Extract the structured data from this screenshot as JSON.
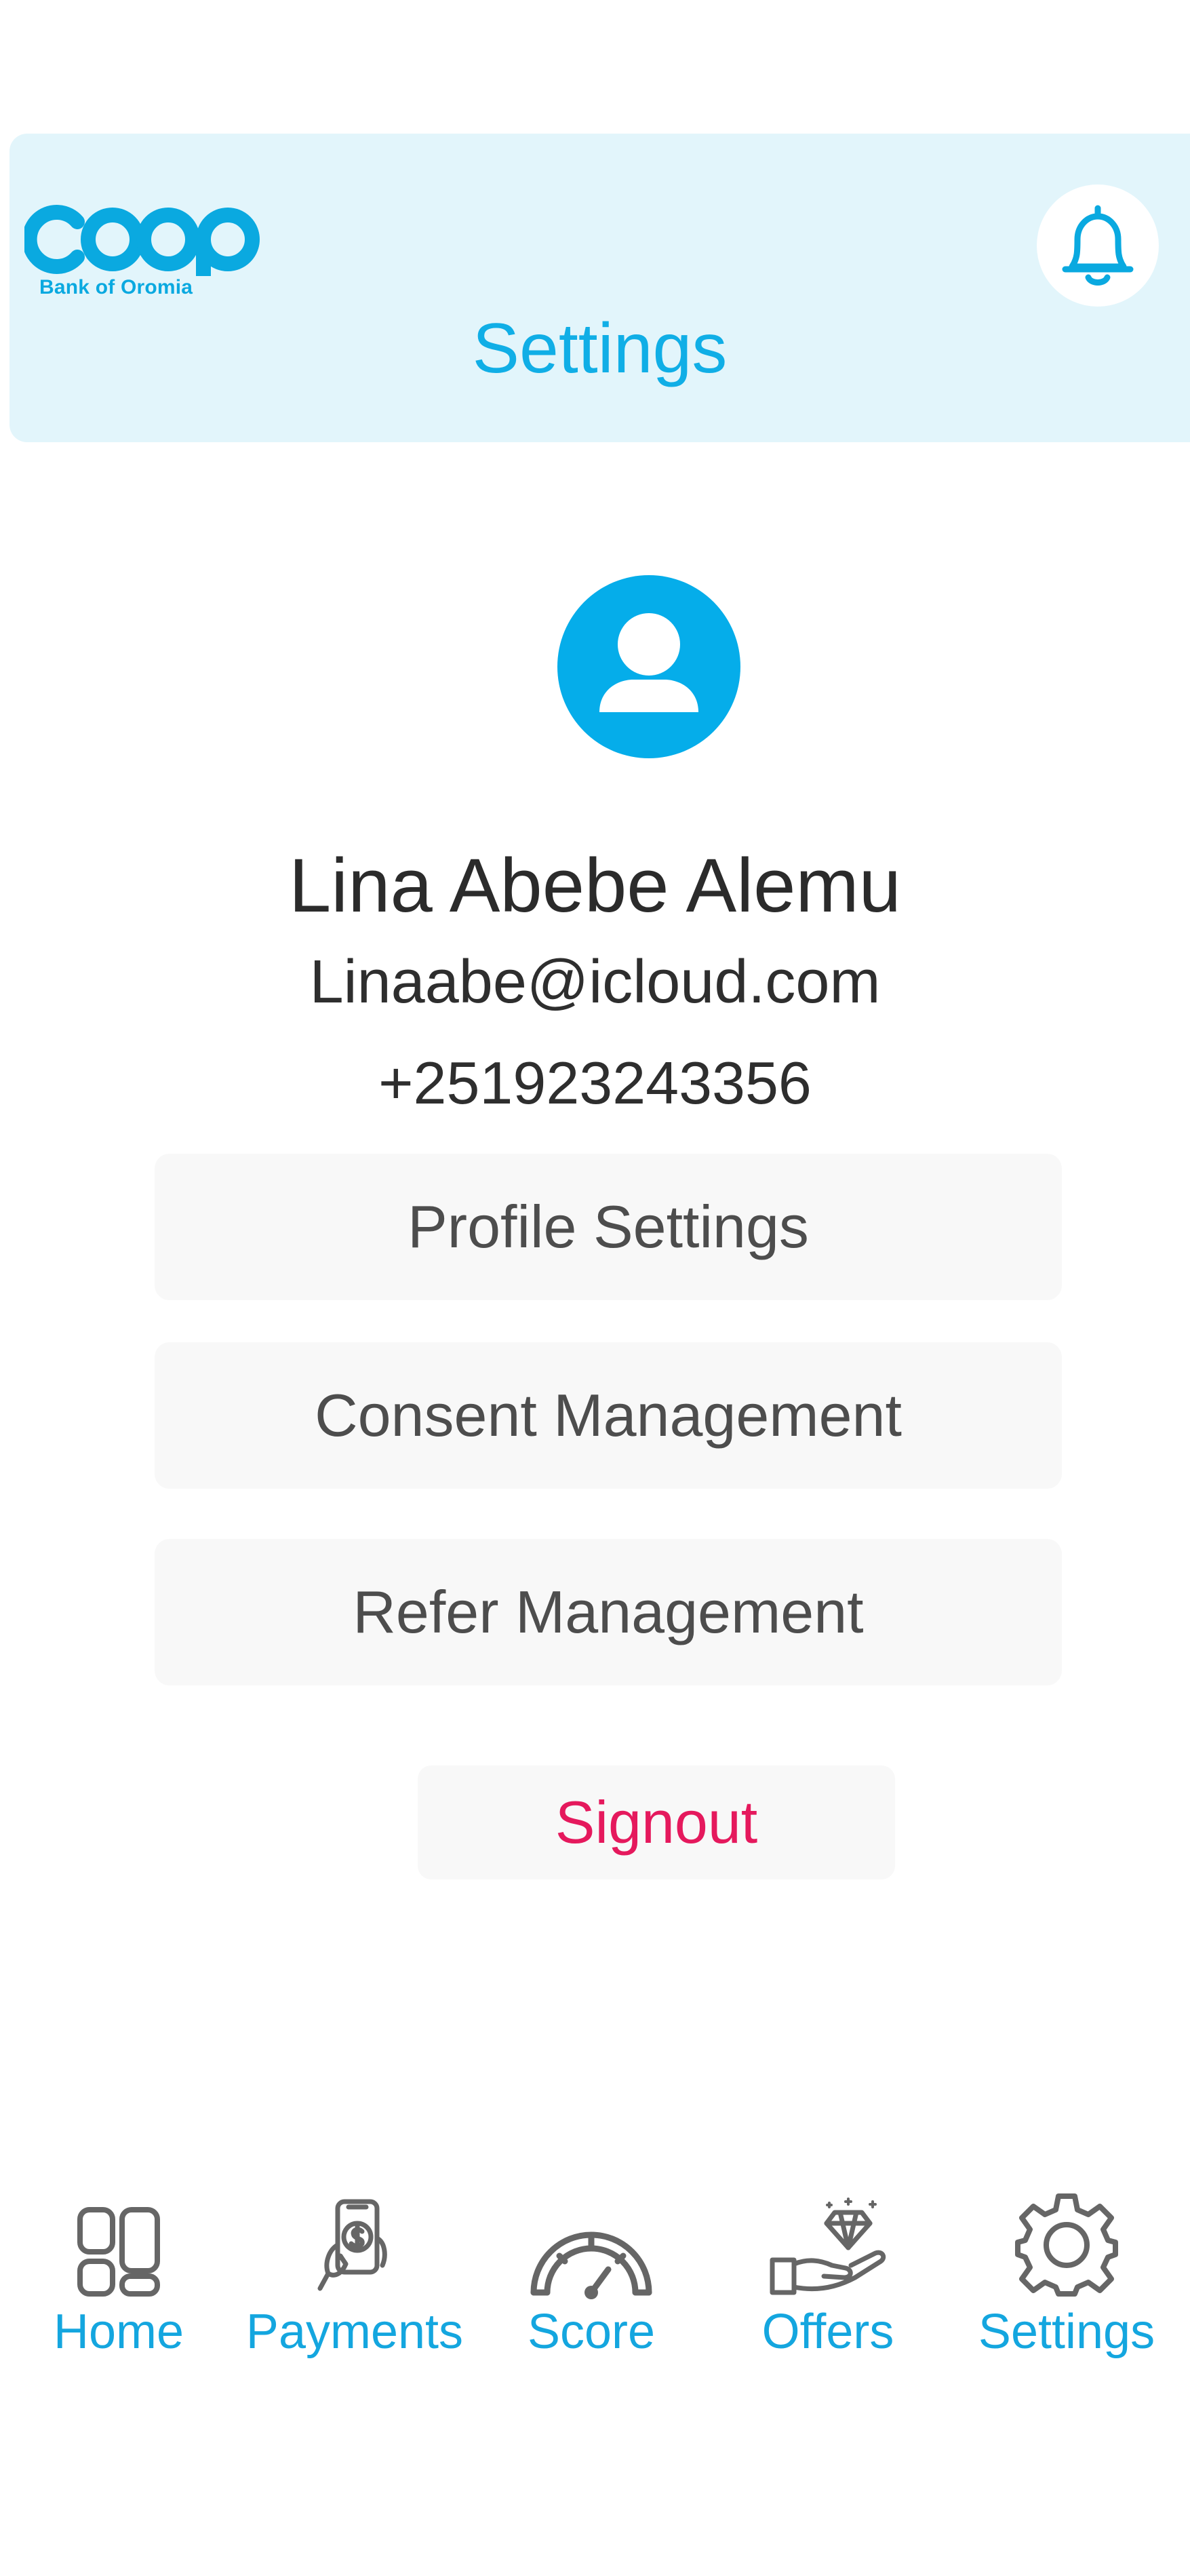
{
  "header": {
    "logo_word": "coop",
    "logo_subtitle": "Bank of Oromia",
    "title": "Settings",
    "bell_icon": "bell-icon"
  },
  "profile": {
    "avatar_icon": "user-avatar-icon",
    "name": "Lina Abebe Alemu",
    "email": "Linaabe@icloud.com",
    "phone": "+251923243356"
  },
  "menu": {
    "profile_settings": "Profile Settings",
    "consent_management": "Consent Management",
    "refer_management": "Refer Management",
    "signout": "Signout"
  },
  "nav": {
    "items": [
      {
        "label": "Home",
        "icon": "home-grid-icon"
      },
      {
        "label": "Payments",
        "icon": "payments-phone-icon"
      },
      {
        "label": "Score",
        "icon": "score-gauge-icon"
      },
      {
        "label": "Offers",
        "icon": "offers-hand-diamond-icon"
      },
      {
        "label": "Settings",
        "icon": "gear-icon"
      }
    ]
  },
  "colors": {
    "brand_blue": "#0aa9e0",
    "header_bg": "#e2f5fb",
    "signout_red": "#e5195d",
    "button_bg": "#f8f8f8"
  }
}
